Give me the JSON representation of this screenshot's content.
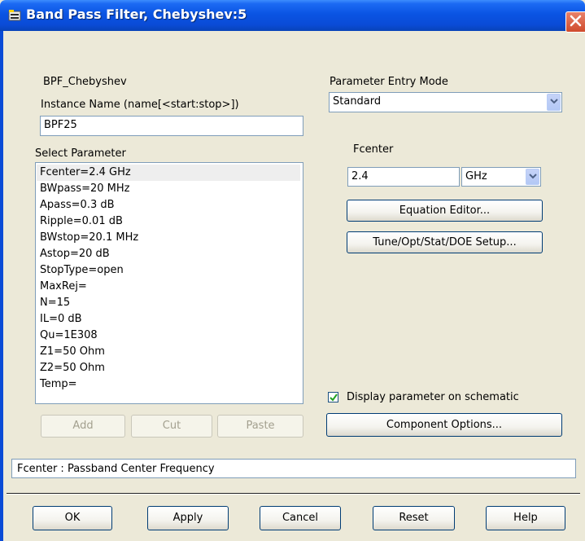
{
  "window": {
    "title": "Band Pass Filter, Chebyshev:5",
    "icon": "component-icon",
    "close_icon": "close-icon"
  },
  "component_name": "BPF_Chebyshev",
  "instance": {
    "label": "Instance Name  (name[<start:stop>])",
    "value": "BPF25"
  },
  "select_parameter": {
    "label": "Select Parameter",
    "items": [
      "Fcenter=2.4 GHz",
      "BWpass=20 MHz",
      "Apass=0.3 dB",
      "Ripple=0.01 dB",
      "BWstop=20.1 MHz",
      "Astop=20 dB",
      "StopType=open",
      "MaxRej=",
      "N=15",
      "IL=0 dB",
      "Qu=1E308",
      "Z1=50 Ohm",
      "Z2=50 Ohm",
      "Temp="
    ],
    "selected": "Fcenter=2.4 GHz"
  },
  "list_buttons": {
    "add": "Add",
    "cut": "Cut",
    "paste": "Paste"
  },
  "entry_mode": {
    "label": "Parameter Entry Mode",
    "value": "Standard"
  },
  "param_editor": {
    "name": "Fcenter",
    "value": "2.4",
    "unit": "GHz",
    "equation_editor": "Equation Editor...",
    "tune_setup": "Tune/Opt/Stat/DOE Setup..."
  },
  "display_checkbox": {
    "label": "Display parameter on schematic",
    "checked": true
  },
  "component_options": "Component Options...",
  "description": "Fcenter : Passband Center Frequency",
  "footer_buttons": {
    "ok": "OK",
    "apply": "Apply",
    "cancel": "Cancel",
    "reset": "Reset",
    "help": "Help"
  }
}
